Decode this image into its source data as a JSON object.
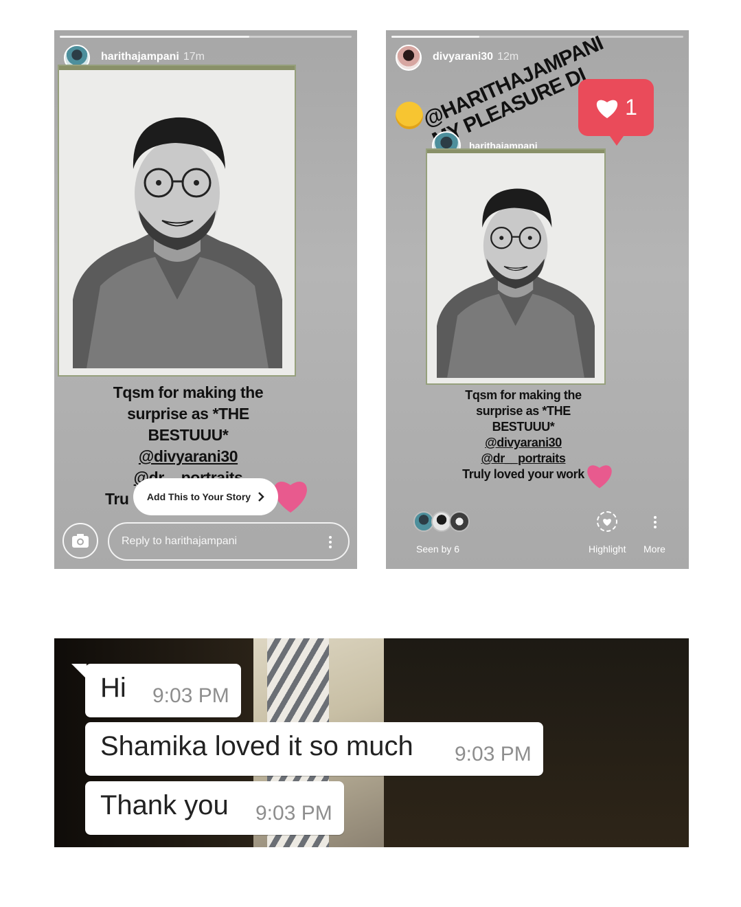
{
  "left_story": {
    "username": "harithajampani",
    "time": "17m",
    "progress": 0.65,
    "caption_lines": [
      "Tqsm for making the",
      "surprise as *THE",
      "BESTUUU*",
      "@divyarani30",
      "@dr__portraits",
      "Tru"
    ],
    "add_story_label": "Add This to Your Story",
    "reply_placeholder": "Reply to harithajampani",
    "icons": {
      "camera": "camera-icon",
      "more": "more-vertical-icon",
      "chevron": "chevron-right-icon",
      "heart": "heart-icon"
    }
  },
  "right_story": {
    "username": "divyarani30",
    "time": "12m",
    "progress": 0.3,
    "mention_line1": "@HARITHAJAMPANI",
    "mention_line2": "MY PLEASURE DI",
    "like_count": "1",
    "reshared_username": "harithajampani",
    "caption_lines": [
      "Tqsm for making the",
      "surprise as *THE",
      "BESTUUU*",
      "@divyarani30",
      "@dr__portraits",
      "Truly loved your work"
    ],
    "seen_by": "Seen by 6",
    "highlight_label": "Highlight",
    "more_label": "More",
    "icons": {
      "highlight": "highlight-heart-icon",
      "more": "more-vertical-icon",
      "like": "heart-icon",
      "emoji": "hugging-emoji-icon"
    }
  },
  "chat": {
    "messages": [
      {
        "text": "Hi",
        "time": "9:03 PM"
      },
      {
        "text": "Shamika loved it so much",
        "time": "9:03 PM"
      },
      {
        "text": "Thank you",
        "time": "9:03 PM"
      }
    ]
  },
  "colors": {
    "story_bg": "#ababab",
    "like_red": "#ea4b5a",
    "sticker_heart_pink": "#e85a8e",
    "chat_bubble": "#ffffff",
    "timestamp_gray": "#8e8e8e"
  }
}
